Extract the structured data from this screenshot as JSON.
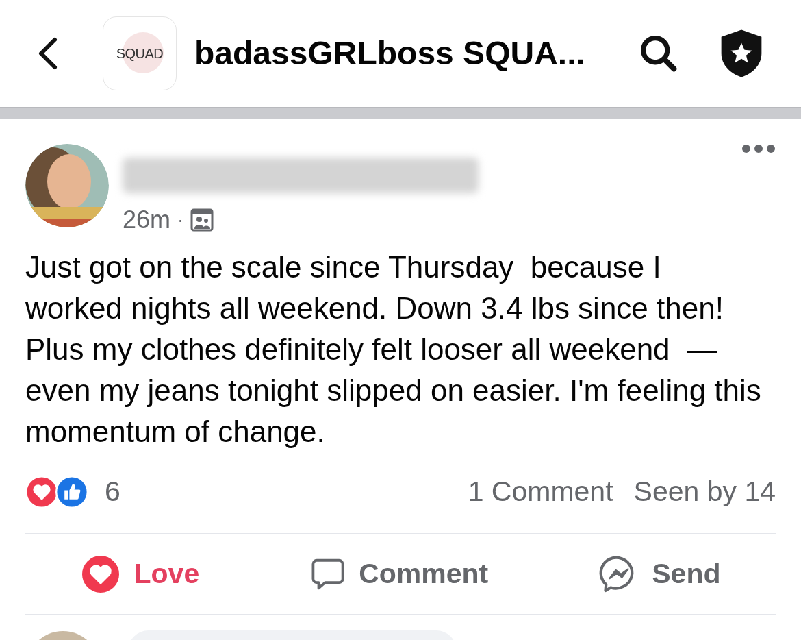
{
  "header": {
    "group_logo_text": "SQUAD",
    "title": "badassGRLboss SQUA..."
  },
  "post": {
    "time": "26m",
    "separator": "·",
    "text": "Just got on the scale since Thursday  because I worked nights all weekend. Down 3.4 lbs since then! Plus my clothes definitely felt looser all weekend  — even my jeans tonight slipped on easier. I'm feeling this momentum of change.",
    "reaction_count": "6",
    "comments": "1 Comment",
    "seen_by": "Seen by 14",
    "actions": [
      {
        "kind": "love",
        "label": "Love",
        "selected": true
      },
      {
        "kind": "comment",
        "label": "Comment",
        "selected": false
      },
      {
        "kind": "send",
        "label": "Send",
        "selected": false
      }
    ]
  }
}
